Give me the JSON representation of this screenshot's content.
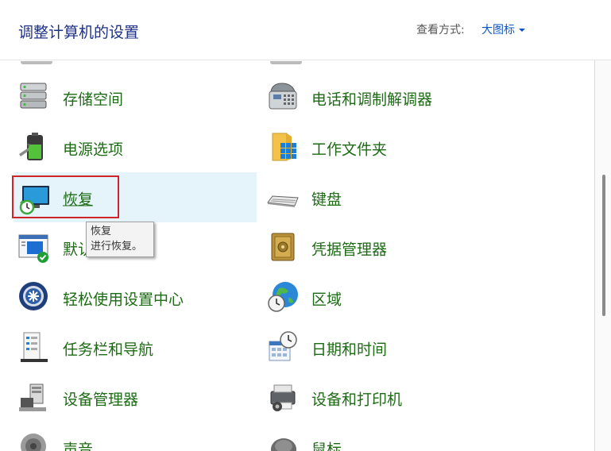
{
  "header": {
    "title": "调整计算机的设置",
    "view_label": "查看方式:",
    "view_value": "大图标"
  },
  "items_left": [
    {
      "name": "storage-spaces",
      "label": "存储空间",
      "icon": "storage-icon"
    },
    {
      "name": "power-options",
      "label": "电源选项",
      "icon": "battery-icon"
    },
    {
      "name": "recovery",
      "label": "恢复",
      "icon": "recovery-icon"
    },
    {
      "name": "default-programs",
      "label": "默认",
      "icon": "default-programs-icon"
    },
    {
      "name": "ease-of-access",
      "label": "轻松使用设置中心",
      "icon": "ease-of-access-icon"
    },
    {
      "name": "taskbar-navigation",
      "label": "任务栏和导航",
      "icon": "taskbar-icon"
    },
    {
      "name": "device-manager",
      "label": "设备管理器",
      "icon": "device-manager-icon"
    },
    {
      "name": "sound",
      "label": "声音",
      "icon": "speaker-icon"
    }
  ],
  "items_right": [
    {
      "name": "phone-modem",
      "label": "电话和调制解调器",
      "icon": "phone-icon"
    },
    {
      "name": "work-folders",
      "label": "工作文件夹",
      "icon": "folder-icon"
    },
    {
      "name": "keyboard",
      "label": "键盘",
      "icon": "keyboard-icon"
    },
    {
      "name": "credential-manager",
      "label": "凭据管理器",
      "icon": "safe-icon"
    },
    {
      "name": "region",
      "label": "区域",
      "icon": "globe-clock-icon"
    },
    {
      "name": "date-time",
      "label": "日期和时间",
      "icon": "calendar-clock-icon"
    },
    {
      "name": "devices-printers",
      "label": "设备和打印机",
      "icon": "printer-icon"
    },
    {
      "name": "mouse",
      "label": "鼠标",
      "icon": "mouse-icon"
    }
  ],
  "tooltip": {
    "title": "恢复",
    "description": "进行恢复。"
  },
  "colors": {
    "title": "#1e3287",
    "link": "#1d6b14",
    "accent": "#0a55c8",
    "hover_bg": "#e5f3fb",
    "selection_frame": "#d0242b"
  }
}
